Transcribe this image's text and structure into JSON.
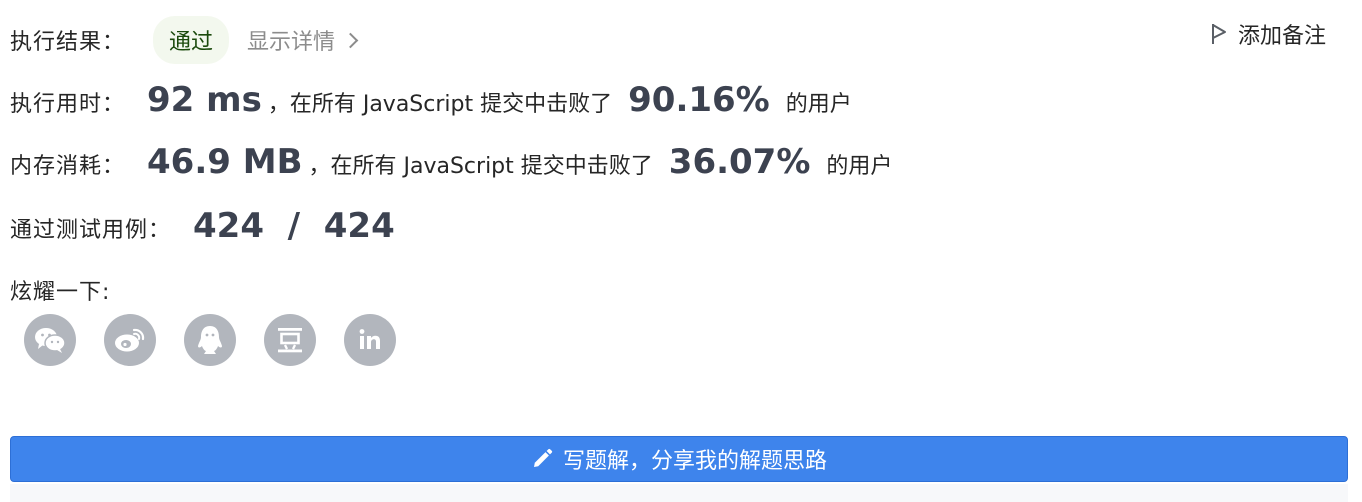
{
  "result": {
    "label": "执行结果：",
    "status": "通过",
    "details_link": "显示详情"
  },
  "add_note": "添加备注",
  "runtime": {
    "label": "执行用时：",
    "value": "92 ms",
    "middle": "，在所有 JavaScript 提交中击败了",
    "percent": "90.16%",
    "suffix": "的用户"
  },
  "memory": {
    "label": "内存消耗：",
    "value": "46.9 MB",
    "middle": "，在所有 JavaScript 提交中击败了",
    "percent": "36.07%",
    "suffix": "的用户"
  },
  "tests": {
    "label": "通过测试用例：",
    "value": "424  /  424"
  },
  "share": {
    "label": "炫耀一下:",
    "icons": [
      "wechat-icon",
      "weibo-icon",
      "qq-icon",
      "douban-icon",
      "linkedin-icon"
    ]
  },
  "write_solution_button": "写题解，分享我的解题思路",
  "colors": {
    "accent": "#3e84ec",
    "pass_badge_bg": "#f3f8ee",
    "icon_bg": "#b2b6bd"
  }
}
